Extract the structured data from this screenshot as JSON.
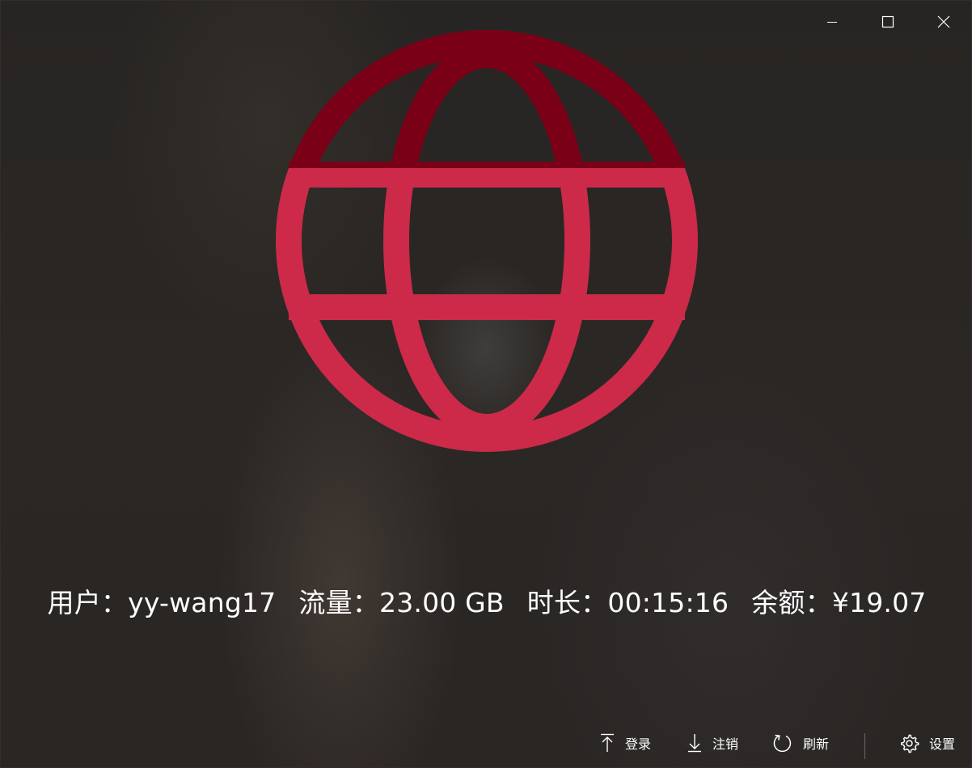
{
  "window": {
    "caption_buttons": {
      "minimize": "minimize-icon",
      "maximize": "maximize-icon",
      "close": "close-icon"
    }
  },
  "status": {
    "icon": "globe-icon",
    "icon_color": "#cc2a48",
    "icon_top_color": "#7a0018",
    "user_label": "用户：",
    "user_value": "yy-wang17",
    "flux_label": "流量：",
    "flux_value": "23.00 GB",
    "time_label": "时长：",
    "time_value": "00:15:16",
    "balance_label": "余额：",
    "balance_value": "¥19.07"
  },
  "commands": {
    "login": {
      "label": "登录",
      "icon": "arrow-up-icon"
    },
    "logout": {
      "label": "注销",
      "icon": "arrow-down-icon"
    },
    "refresh": {
      "label": "刷新",
      "icon": "refresh-icon"
    },
    "settings": {
      "label": "设置",
      "icon": "gear-icon"
    }
  }
}
